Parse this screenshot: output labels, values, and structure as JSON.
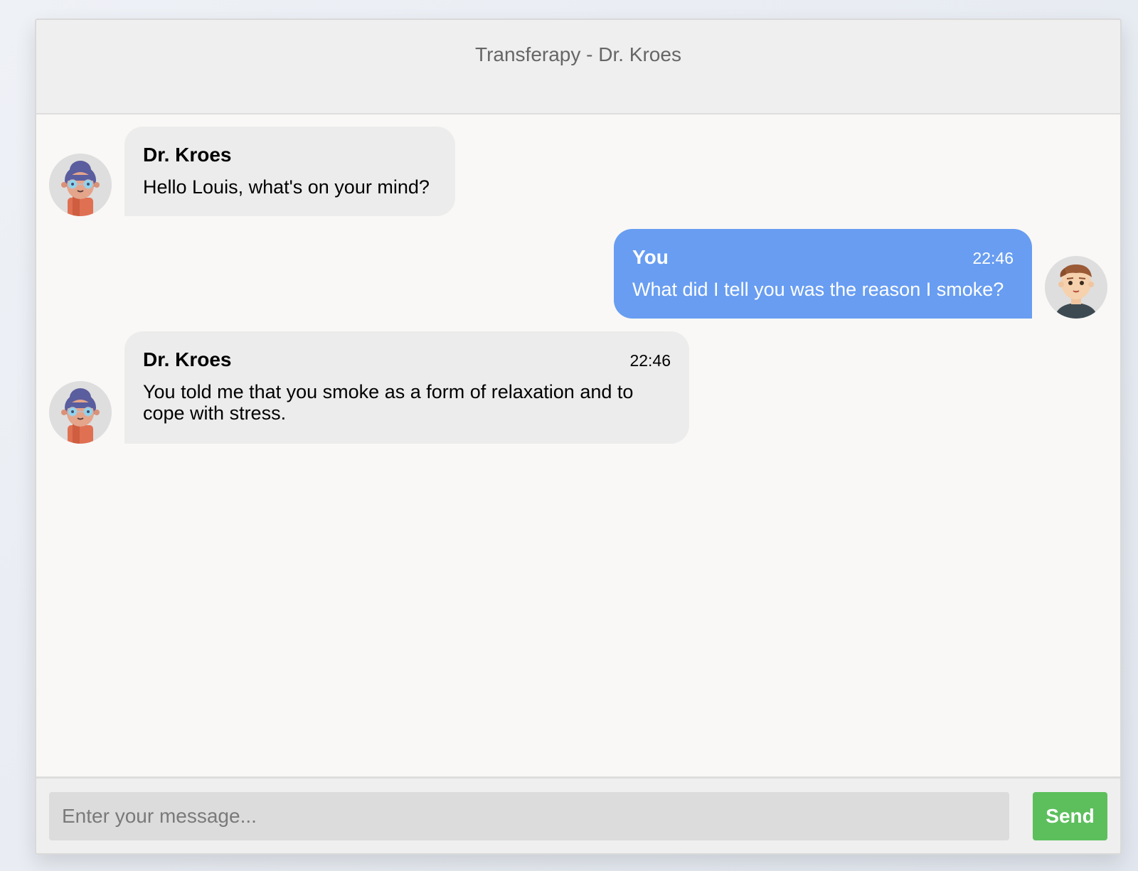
{
  "header": {
    "title": "Transferapy - Dr. Kroes"
  },
  "messages": [
    {
      "side": "left",
      "sender": "Dr. Kroes",
      "time": "",
      "text": "Hello Louis, what's on your mind?",
      "avatar": "therapist-avatar-icon"
    },
    {
      "side": "right",
      "sender": "You",
      "time": "22:46",
      "text": "What did I tell you was the reason I smoke?",
      "avatar": "user-avatar-icon"
    },
    {
      "side": "left",
      "sender": "Dr. Kroes",
      "time": "22:46",
      "text": "You told me that you smoke as a form of relaxation and to cope with stress.",
      "avatar": "therapist-avatar-icon"
    }
  ],
  "composer": {
    "placeholder": "Enter your message...",
    "value": "",
    "send_label": "Send"
  },
  "colors": {
    "user_bubble": "#689df1",
    "bot_bubble": "#ececec",
    "send_button": "#5cbf5c",
    "header_bg": "#efefef",
    "chat_bg": "#f9f8f6"
  }
}
